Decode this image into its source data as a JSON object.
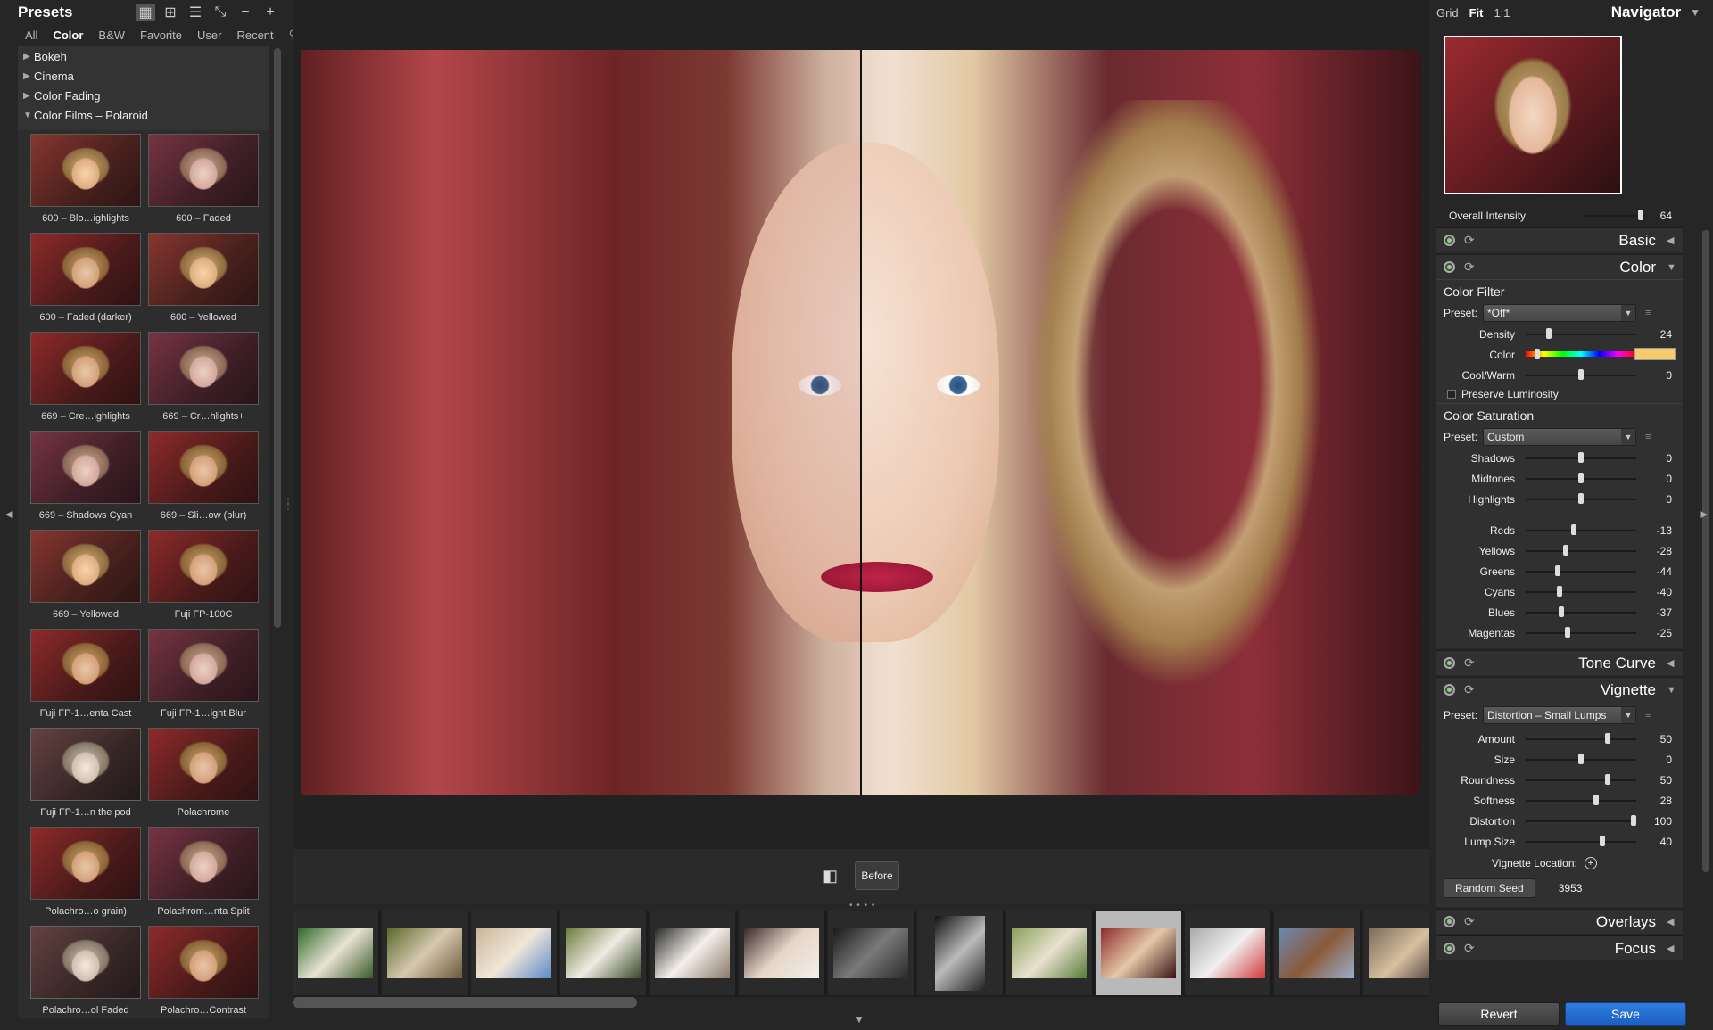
{
  "presets": {
    "title": "Presets",
    "filters": [
      "All",
      "Color",
      "B&W",
      "Favorite",
      "User",
      "Recent"
    ],
    "active_filter": "Color",
    "categories": [
      {
        "label": "Bokeh",
        "open": false
      },
      {
        "label": "Cinema",
        "open": false
      },
      {
        "label": "Color Fading",
        "open": false
      },
      {
        "label": "Color Films – Polaroid",
        "open": true
      }
    ],
    "thumbnails": [
      "600 – Blo…ighlights",
      "600 – Faded",
      "600 – Faded (darker)",
      "600 – Yellowed",
      "669 – Cre…ighlights",
      "669 – Cr…hlights+",
      "669 – Shadows Cyan",
      "669 – Sli…ow (blur)",
      "669 – Yellowed",
      "Fuji FP-100C",
      "Fuji FP-1…enta Cast",
      "Fuji FP-1…ight Blur",
      "Fuji FP-1…n the pod",
      "Polachrome",
      "Polachro…o grain)",
      "Polachrom…nta Split",
      "Polachro…ol Faded",
      "Polachro…Contrast"
    ]
  },
  "compare": {
    "before_label": "Before"
  },
  "navigator": {
    "title": "Navigator",
    "zoom_options": [
      "Grid",
      "Fit",
      "1:1"
    ],
    "active_zoom": "Fit"
  },
  "adjust": {
    "overall_intensity_label": "Overall Intensity",
    "overall_intensity": 64,
    "sections": {
      "basic": "Basic",
      "color": "Color",
      "tone_curve": "Tone Curve",
      "vignette": "Vignette",
      "overlays": "Overlays",
      "focus": "Focus"
    },
    "color_filter": {
      "title": "Color Filter",
      "preset_label": "Preset:",
      "preset": "*Off*",
      "density_label": "Density",
      "density": 24,
      "color_label": "Color",
      "swatch": "#f5cb6d",
      "coolwarm_label": "Cool/Warm",
      "coolwarm": 0,
      "preserve_label": "Preserve Luminosity"
    },
    "color_saturation": {
      "title": "Color Saturation",
      "preset_label": "Preset:",
      "preset": "Custom",
      "tones": [
        {
          "label": "Shadows",
          "value": 0
        },
        {
          "label": "Midtones",
          "value": 0
        },
        {
          "label": "Highlights",
          "value": 0
        }
      ],
      "colors": [
        {
          "label": "Reds",
          "value": -13
        },
        {
          "label": "Yellows",
          "value": -28
        },
        {
          "label": "Greens",
          "value": -44
        },
        {
          "label": "Cyans",
          "value": -40
        },
        {
          "label": "Blues",
          "value": -37
        },
        {
          "label": "Magentas",
          "value": -25
        }
      ]
    },
    "vignette": {
      "preset_label": "Preset:",
      "preset": "Distortion – Small Lumps",
      "sliders": [
        {
          "label": "Amount",
          "value": 50
        },
        {
          "label": "Size",
          "value": 0
        },
        {
          "label": "Roundness",
          "value": 50
        },
        {
          "label": "Softness",
          "value": 28
        },
        {
          "label": "Distortion",
          "value": 100
        },
        {
          "label": "Lump Size",
          "value": 40
        }
      ],
      "location_label": "Vignette Location:",
      "random_seed_label": "Random Seed",
      "random_seed": 3953
    }
  },
  "actions": {
    "revert": "Revert",
    "save": "Save"
  }
}
